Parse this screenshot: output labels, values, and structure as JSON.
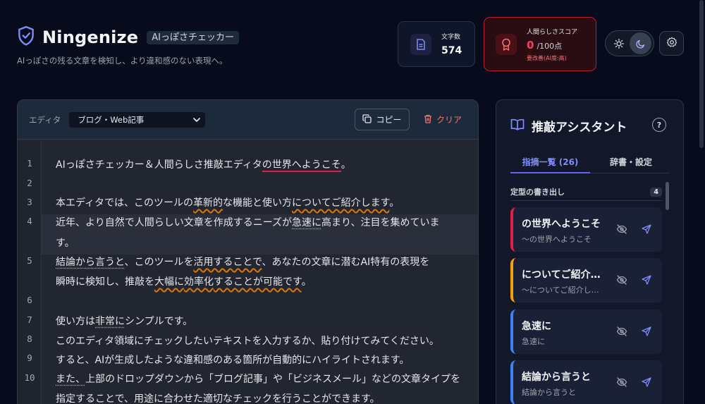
{
  "app": {
    "title": "Ningenize",
    "badge": "AIっぽさチェッカー",
    "subtitle": "AIっぽさの残る文章を検知し、より違和感のない表現へ。"
  },
  "stats": {
    "char_count_label": "文字数",
    "char_count_value": "574",
    "score_label": "人間らしさスコア",
    "score_value": "0",
    "score_max": "/100点",
    "score_status": "要改善(AI度:高)"
  },
  "editor": {
    "label": "エディタ",
    "select_value": "ブログ・Web記事",
    "copy_label": "コピー",
    "clear_label": "クリア",
    "line_numbers": [
      "1",
      "2",
      "3",
      "4",
      "",
      "5",
      "",
      "6",
      "7",
      "8",
      "9",
      "10",
      ""
    ],
    "text": {
      "l1a": "AIっぽさチェッカー＆人間らしさ推敲エディタ",
      "l1b": "の世界へようこそ",
      "l1c": "。",
      "l3a": "本エディタでは、このツールの",
      "l3b": "革新的",
      "l3c": "な機能と使い方",
      "l3d": "についてご紹介します",
      "l3e": "。",
      "l4a": "近年、より自然で人間らしい文章を作成するニーズが",
      "l4b": "急速に",
      "l4c": "高まり、注目を集めていま",
      "l4d": "す。",
      "l5a": "結論から言うと",
      "l5b": "、このツールを",
      "l5c": "活用することで",
      "l5d": "、あなたの文章に潜むAI特有の表現を",
      "l5e": "瞬時に検知し、推敲を",
      "l5f": "大幅に",
      "l5g": "効率化",
      "l5h": "することが可能です",
      "l5i": "。",
      "l7a": "使い方は",
      "l7b": "非常に",
      "l7c": "シンプルです。",
      "l8": "このエディタ領域にチェックしたいテキストを入力するか、貼り付けてみてください。",
      "l9": "すると、AIが生成したような違和感のある箇所が自動的にハイライトされます。",
      "l10a": "また、",
      "l10b": "上部のドロップダウンから「ブログ記事」や「ビジネスメール」などの文章タイプを",
      "l10c": "指定することで、用途に合わせた適切なチェックを行うことができます。"
    }
  },
  "assistant": {
    "title": "推敲アシスタント",
    "help": "?",
    "tab_active": "指摘一覧 (26)",
    "tab_inactive": "辞書・設定",
    "group_label": "定型の書き出し",
    "group_count": "4",
    "cards": [
      {
        "title": "の世界へようこそ",
        "sub": "～の世界へようこそ",
        "color": "#e11d48"
      },
      {
        "title": "についてご紹介…",
        "sub": "～についてご紹介し…",
        "color": "#f59e0b"
      },
      {
        "title": "急速に",
        "sub": "急速に",
        "color": "#3b82f6"
      },
      {
        "title": "結論から言うと",
        "sub": "結論から言うと",
        "color": "#3b82f6"
      }
    ]
  },
  "colors": {
    "background": "#070b1c",
    "accent": "#6366f1",
    "danger": "#e11d48",
    "warning": "#d97706"
  }
}
